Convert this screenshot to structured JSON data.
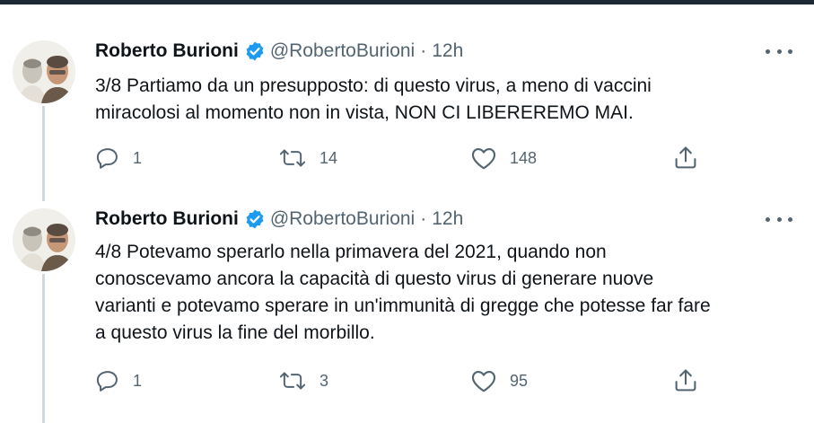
{
  "tweets": [
    {
      "author_name": "Roberto Burioni",
      "author_handle": "@RobertoBurioni",
      "separator": "·",
      "time": "12h",
      "lines": [
        "3/8 Partiamo da un presupposto: di questo virus, a meno di vaccini",
        "miracolosi al momento non in vista, NON CI LIBEREREMO MAI."
      ],
      "replies": "1",
      "retweets": "14",
      "likes": "148"
    },
    {
      "author_name": "Roberto Burioni",
      "author_handle": "@RobertoBurioni",
      "separator": "·",
      "time": "12h",
      "lines": [
        "4/8 Potevamo sperarlo nella primavera del 2021, quando non",
        "conoscevamo ancora la capacità di questo virus di generare nuove",
        "varianti e potevamo sperare in un'immunità di gregge che potesse far fare",
        "a questo virus la fine del morbillo."
      ],
      "replies": "1",
      "retweets": "3",
      "likes": "95"
    }
  ],
  "icons": {
    "reply": "reply-icon",
    "retweet": "retweet-icon",
    "like": "heart-icon",
    "share": "share-icon",
    "more": "more-options-icon",
    "verified": "verified-badge-icon"
  },
  "colors": {
    "text": "#0f1419",
    "secondary": "#536471",
    "verified": "#1d9bf0",
    "thread_line": "#cfd9de"
  }
}
